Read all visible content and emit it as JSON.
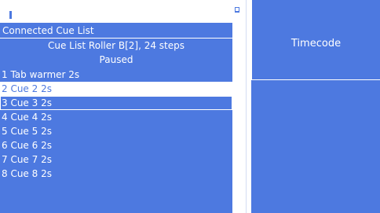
{
  "cue_panel": {
    "title": "Connected Cue List",
    "cue_list_name": "Cue List Roller B[2], 24 steps",
    "state": "Paused",
    "steps": [
      "1 Tab warmer 2s",
      "2 Cue  2 2s",
      "3 Cue  3 2s",
      "4 Cue  4 2s",
      "5 Cue  5 2s",
      "6 Cue  6 2s",
      "7 Cue  7 2s",
      "8 Cue  8 2s"
    ],
    "current_step_index": 1,
    "selected_step_index": 2
  },
  "timecode": {
    "label": "Timecode"
  },
  "colors": {
    "panel_blue": "#4d79e0",
    "text": "#ffffff"
  },
  "icons": {
    "divider_grip": "splitter-grip-icon"
  }
}
